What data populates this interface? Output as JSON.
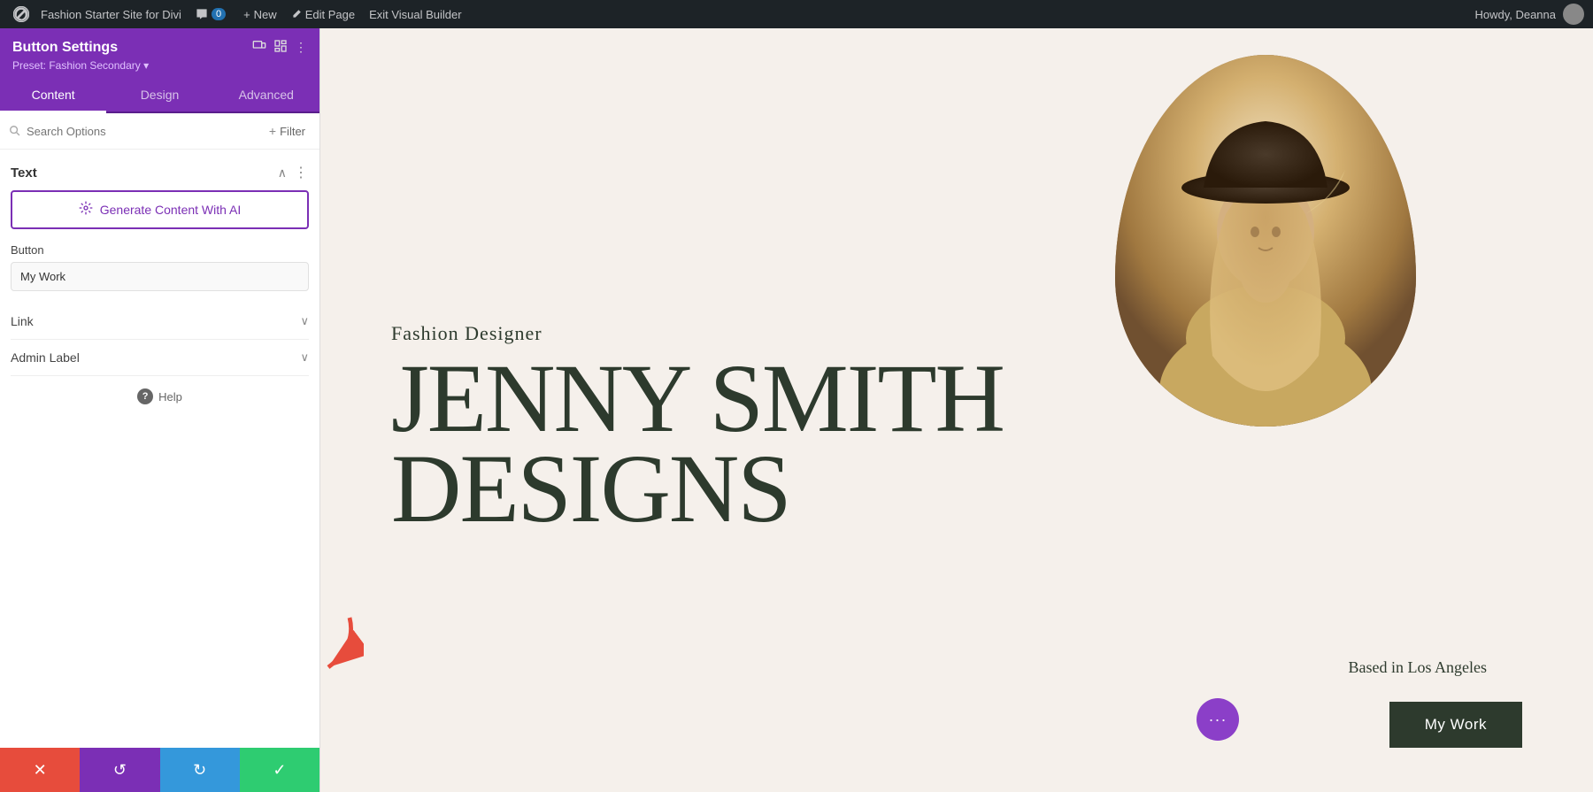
{
  "admin_bar": {
    "site_name": "Fashion Starter Site for Divi",
    "comment_count": "0",
    "new_label": "New",
    "edit_page_label": "Edit Page",
    "exit_builder_label": "Exit Visual Builder",
    "howdy_label": "Howdy, Deanna"
  },
  "panel": {
    "title": "Button Settings",
    "preset_label": "Preset: Fashion Secondary ▾",
    "tabs": [
      {
        "id": "content",
        "label": "Content",
        "active": true
      },
      {
        "id": "design",
        "label": "Design",
        "active": false
      },
      {
        "id": "advanced",
        "label": "Advanced",
        "active": false
      }
    ],
    "search_placeholder": "Search Options",
    "filter_label": "+ Filter",
    "text_section": {
      "title": "Text",
      "ai_button_label": "Generate Content With AI",
      "button_field_label": "Button",
      "button_field_value": "My Work"
    },
    "link_section": {
      "title": "Link"
    },
    "admin_label_section": {
      "title": "Admin Label"
    },
    "help_label": "Help"
  },
  "bottom_toolbar": {
    "cancel_icon": "✕",
    "undo_icon": "↺",
    "redo_icon": "↻",
    "save_icon": "✓"
  },
  "canvas": {
    "designer_label": "Fashion Designer",
    "name_line1": "JENNY SMITH",
    "name_line2": "DESIGNS",
    "based_label": "Based in Los Angeles",
    "my_work_btn": "My Work",
    "dots_icon": "···"
  }
}
